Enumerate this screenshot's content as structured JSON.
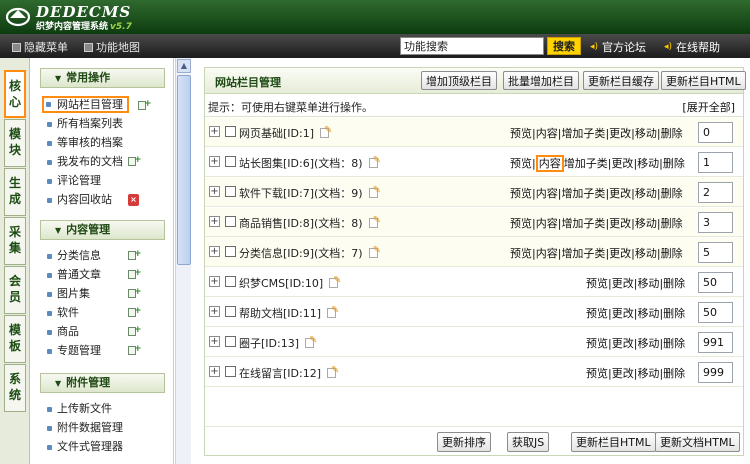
{
  "header": {
    "logo_text": "DEDECMS",
    "logo_sub": "织梦内容管理系统",
    "logo_version": "v5.7"
  },
  "toolbar": {
    "hide_menu": "隐藏菜单",
    "func_map": "功能地图",
    "search_value": "功能搜索",
    "search_button": "搜索",
    "forum": "官方论坛",
    "help": "在线帮助"
  },
  "left_tabs": [
    "核心",
    "模块",
    "生成",
    "采集",
    "会员",
    "模板",
    "系统"
  ],
  "sidebar": {
    "groups": [
      {
        "title": "常用操作",
        "items": [
          "网站栏目管理",
          "所有档案列表",
          "等审核的档案",
          "我发布的文档",
          "评论管理",
          "内容回收站"
        ]
      },
      {
        "title": "内容管理",
        "items": [
          "分类信息",
          "普通文章",
          "图片集",
          "软件",
          "商品",
          "专题管理"
        ]
      },
      {
        "title": "附件管理",
        "items": [
          "上传新文件",
          "附件数据管理",
          "文件式管理器"
        ]
      }
    ]
  },
  "main": {
    "title": "网站栏目管理",
    "buttons": [
      "增加顶级栏目",
      "批量增加栏目",
      "更新栏目缓存",
      "更新栏目HTML"
    ],
    "hint": "提示：可使用右键菜单进行操作。",
    "expand_all": "[展开全部]",
    "categories": [
      {
        "name": "网页基础[ID:1]",
        "ops": [
          "预览",
          "内容",
          "增加子类",
          "更改",
          "移动",
          "删除"
        ],
        "order": "0"
      },
      {
        "name": "站长图集[ID:6](文档：8)",
        "ops": [
          "预览",
          "内容",
          "增加子类",
          "更改",
          "移动",
          "删除"
        ],
        "order": "1"
      },
      {
        "name": "软件下载[ID:7](文档：9)",
        "ops": [
          "预览",
          "内容",
          "增加子类",
          "更改",
          "移动",
          "删除"
        ],
        "order": "2"
      },
      {
        "name": "商品销售[ID:8](文档：8)",
        "ops": [
          "预览",
          "内容",
          "增加子类",
          "更改",
          "移动",
          "删除"
        ],
        "order": "3"
      },
      {
        "name": "分类信息[ID:9](文档：7)",
        "ops": [
          "预览",
          "内容",
          "增加子类",
          "更改",
          "移动",
          "删除"
        ],
        "order": "5"
      },
      {
        "name": "织梦CMS[ID:10]",
        "ops": [
          "预览",
          "更改",
          "移动",
          "删除"
        ],
        "order": "50"
      },
      {
        "name": "帮助文档[ID:11]",
        "ops": [
          "预览",
          "更改",
          "移动",
          "删除"
        ],
        "order": "50"
      },
      {
        "name": "圈子[ID:13]",
        "ops": [
          "预览",
          "更改",
          "移动",
          "删除"
        ],
        "order": "991"
      },
      {
        "name": "在线留言[ID:12]",
        "ops": [
          "预览",
          "更改",
          "移动",
          "删除"
        ],
        "order": "999"
      }
    ],
    "footer_buttons": [
      "更新排序",
      "获取JS",
      "更新栏目HTML",
      "更新文档HTML"
    ]
  },
  "colors": {
    "header_green": "#0e3c10",
    "highlight_orange": "#ff8b10",
    "title_green": "#1f4a14"
  }
}
